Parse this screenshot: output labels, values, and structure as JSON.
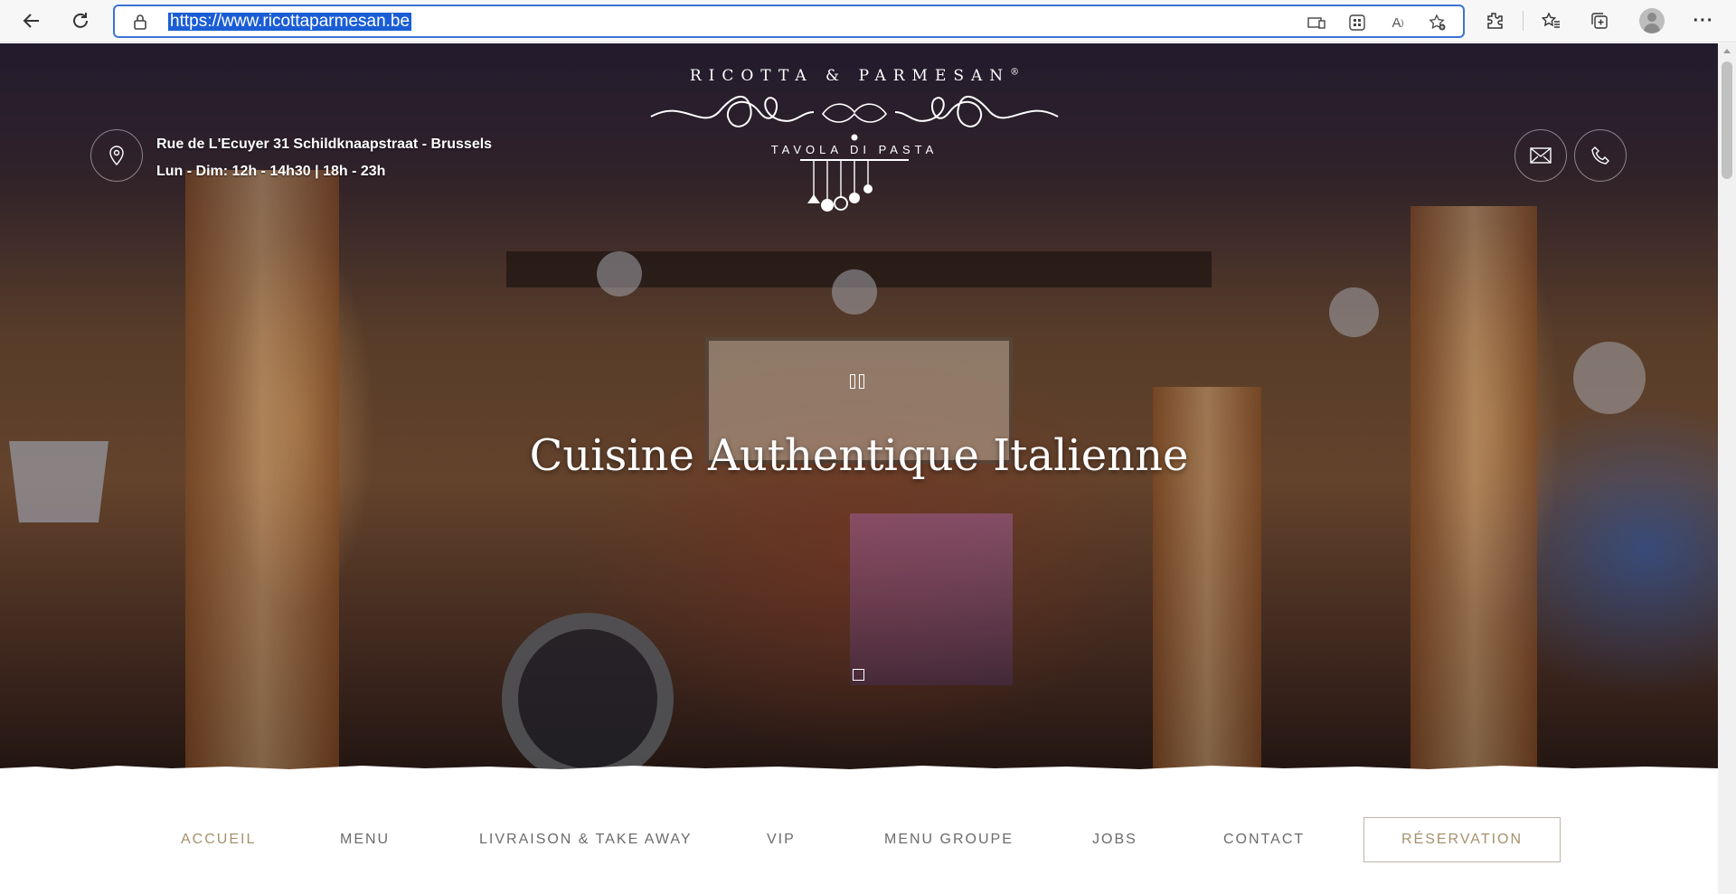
{
  "browser": {
    "url": "https://www.ricottaparmesan.be",
    "icons": [
      "back-arrow-icon",
      "refresh-icon",
      "lock-icon",
      "device-icon",
      "apps-grid-icon",
      "read-aloud-icon",
      "favorite-add-icon",
      "extensions-icon",
      "favorites-icon",
      "collections-icon",
      "profile-avatar",
      "more-icon"
    ]
  },
  "header": {
    "address": "Rue de L'Ecuyer 31 Schildknaapstraat - Brussels",
    "hours": "Lun - Dim: 12h - 14h30 | 18h - 23h"
  },
  "logo": {
    "name": "RICOTTA & PARMESAN",
    "registered": "®",
    "tagline": "TAVOLA DI PASTA"
  },
  "hero": {
    "headline": "Cuisine Authentique Italienne"
  },
  "nav": {
    "items": [
      "ACCUEIL",
      "MENU",
      "LIVRAISON & TAKE AWAY",
      "VIP",
      "MENU GROUPE",
      "JOBS",
      "CONTACT"
    ],
    "active": "ACCUEIL",
    "reservation": "RÉSERVATION"
  },
  "colors": {
    "accent": "#a6906b",
    "nav_text": "#6b6b6b",
    "url_highlight": "#1a5dd6"
  }
}
